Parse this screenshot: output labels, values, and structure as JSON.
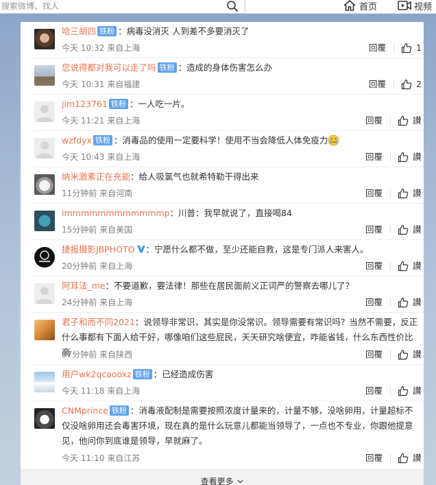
{
  "search": {
    "placeholder": "搜索微博、找人"
  },
  "nav": {
    "home": "首页",
    "video": "视频"
  },
  "comments": [
    {
      "user": "哈三胡四",
      "badge": "铁粉",
      "text": "：病毒没消灭 人到差不多要消灭了",
      "time": "今天 10:32 来自上海",
      "reply": "回覆",
      "likes": "1"
    },
    {
      "user": "您说得都对我可以走了吗",
      "badge": "铁粉",
      "text": "：造成的身体伤害怎么办",
      "time": "今天 10:31 来自福建",
      "reply": "回覆",
      "likes": "2"
    },
    {
      "user": "jim123761",
      "badge": "铁粉",
      "text": "：一人吃一片。",
      "time": "今天 11:21 来自上海",
      "reply": "回覆",
      "likes": "讃"
    },
    {
      "user": "wzfdyx",
      "badge": "铁粉",
      "text": "：消毒品的使用一定要科学！使用不当会降低人体免疫力",
      "time": "今天 10:43 来自上海",
      "reply": "回覆",
      "likes": "讃"
    },
    {
      "user": "纳米激素正在充能",
      "badge": "",
      "text": "：给人吸氯气也就希特勒干得出来",
      "time": "11分钟前 来自河南",
      "reply": "回覆",
      "likes": "讃"
    },
    {
      "user": "immmmmmmmmmmmp",
      "badge": "",
      "text": "：川普：我早就说了，直接喝84",
      "time": "15分钟前 来自美国",
      "reply": "回覆",
      "likes": "讃"
    },
    {
      "user": "捷报摄影JBPHOTO",
      "badge": "",
      "text": "：宁愿什么都不做，至少还能自救，这是专门派人来害人。",
      "time": "20分钟前 来自上海",
      "reply": "回覆",
      "likes": "讃"
    },
    {
      "user": "阿耳法_me",
      "badge": "",
      "text": "：不要道歉，要法律！那些在居民面前义正词严的警察去哪儿了？",
      "time": "24分钟前 来自上海",
      "reply": "回覆",
      "likes": "讃"
    },
    {
      "user": "君子和而不同2021",
      "badge": "",
      "text": "：说领导非常识，其实是你没常识。领导需要有常识吗？当然不需要，反正什么事都有下面人给干好，哪像咱们这些屁民，天天研究啥便宜，咋能省钱，什么东西性价比高",
      "time": "37分钟前 来自陕西",
      "reply": "回覆",
      "likes": "讃"
    },
    {
      "user": "用户wk2qcaooxz",
      "badge": "铁粉",
      "text": "：已经造成伤害",
      "time": "今天 11:18 来自上海",
      "reply": "回覆",
      "likes": "讃"
    },
    {
      "user": "CNMprince",
      "badge": "铁粉",
      "text": "：消毒液配制是需要按照浓度计量来的，计量不够，没啥卵用，计量超标不仅没啥卵用还会毒害环境，现在真的是什么玩意儿都能当领导了，一点也不专业，你跟他提意见，他问你到底谁是领导，早就麻了。",
      "time": "今天 11:10 来自江苏",
      "reply": "回覆",
      "likes": "讃"
    }
  ],
  "more": "查看更多"
}
